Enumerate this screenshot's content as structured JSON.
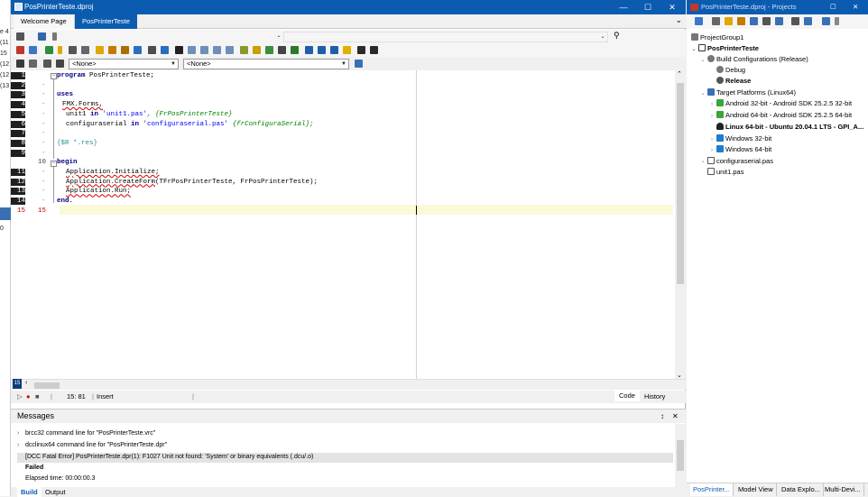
{
  "left_strip": {
    "labels": [
      "e 4",
      "(11",
      "15",
      "(12",
      "(12",
      "(13"
    ],
    "bottom_label": "0"
  },
  "editor_window": {
    "title": "PosPrinterTeste.dproj",
    "tabs": [
      {
        "label": "Welcome Page"
      },
      {
        "label": "PosPrinterTeste"
      }
    ],
    "combo1": "<None>",
    "combo2": "<None>",
    "line_numbers": [
      "1",
      "2",
      "3",
      "4",
      "5",
      "6",
      "7",
      "8",
      "9",
      "10",
      "11",
      "12",
      "13",
      "14",
      "15"
    ],
    "code": {
      "l1_kw": "program",
      "l1_rest": " PosPrinterTeste;",
      "l3_kw": "uses",
      "l4": "FMX.Forms,",
      "l5_a": "unit1 ",
      "l5_in": "in",
      "l5_str": " 'unit1.pas'",
      "l5_cm": ", {FrPosPrinterTeste}",
      "l6_a": "configuraserial ",
      "l6_in": "in",
      "l6_str": " 'configuraserial.pas'",
      "l6_cm": " {frConfiguraSerial};",
      "l8": "{$R *.res}",
      "l10_kw": "begin",
      "l11": "Application.Initialize;",
      "l12_a": "Application.CreateForm",
      "l12_b": "(TFrPosPrinterTeste, FrPosPrinterTeste);",
      "l13": "Application.Run;",
      "l14_kw": "end."
    },
    "status": {
      "position": "15: 81",
      "mode": "Insert",
      "code_tab": "Code",
      "history_tab": "History"
    },
    "messages": {
      "title": "Messages",
      "pin": "↕",
      "close": "✕",
      "lines": [
        {
          "text": "brcc32 command line for \"PosPrinterTeste.vrc\""
        },
        {
          "text": "dcclinux64 command line for \"PosPrinterTeste.dpr\""
        },
        {
          "text": "[DCC Fatal Error] PosPrinterTeste.dpr(1): F1027 Unit not found: 'System' or binary equivalents (.dcu/.o)"
        },
        {
          "text": "Failed"
        },
        {
          "text": "Elapsed time: 00:00:00.3"
        }
      ],
      "tabs": [
        {
          "label": "Build"
        },
        {
          "label": "Output"
        }
      ]
    }
  },
  "projects": {
    "title": "PosPrinterTeste.dproj - Projects",
    "tree": [
      {
        "label": "ProjectGroup1"
      },
      {
        "label": "PosPrinterTeste"
      },
      {
        "label": "Build Configurations (Release)"
      },
      {
        "label": "Debug"
      },
      {
        "label": "Release"
      },
      {
        "label": "Target Platforms (Linux64)"
      },
      {
        "label": "Android 32-bit - Android SDK 25.2.5 32-bit"
      },
      {
        "label": "Android 64-bit - Android SDK 25.2.5 64-bit"
      },
      {
        "label": "Linux 64-bit - Ubuntu 20.04.1 LTS - GPI_A..."
      },
      {
        "label": "Windows 32-bit"
      },
      {
        "label": "Windows 64-bit"
      },
      {
        "label": "configuraserial.pas"
      },
      {
        "label": "unit1.pas"
      }
    ],
    "bottom_tabs": [
      {
        "label": "PosPrinter..."
      },
      {
        "label": "Model View"
      },
      {
        "label": "Data Explo..."
      },
      {
        "label": "Multi-Devi..."
      }
    ]
  },
  "colors": {
    "accent": "#0b5cb0",
    "error_red": "#d00000",
    "keyword": "#000080",
    "string": "#0000ff",
    "comment": "#008000"
  }
}
